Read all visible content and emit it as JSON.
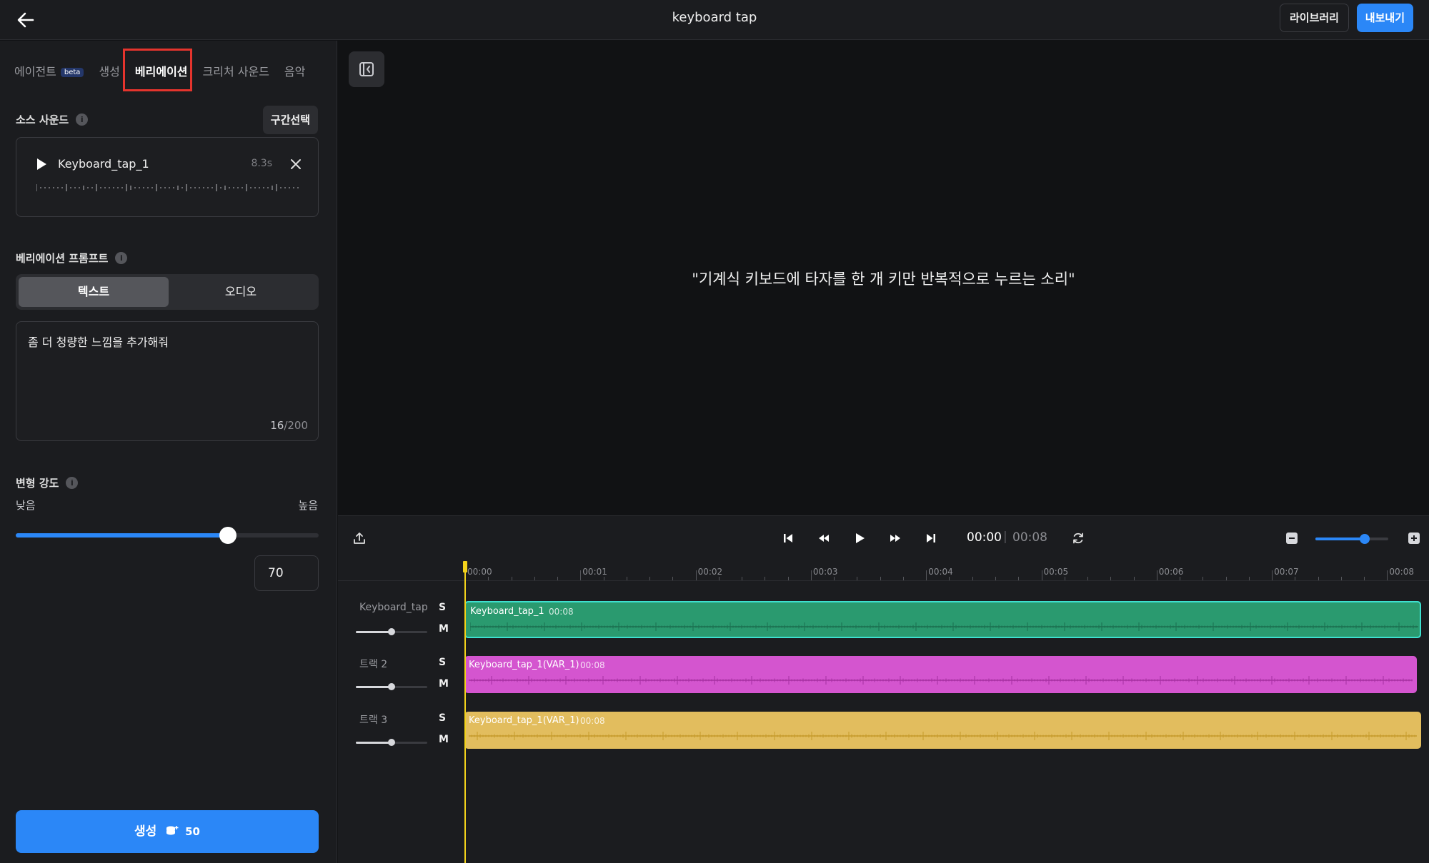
{
  "header": {
    "title": "keyboard tap",
    "library_label": "라이브러리",
    "export_label": "내보내기"
  },
  "left_panel": {
    "tabs": [
      {
        "label": "에이전트",
        "badge": "beta"
      },
      {
        "label": "생성"
      },
      {
        "label": "베리에이션",
        "active": true
      },
      {
        "label": "크리처 사운드"
      },
      {
        "label": "음악"
      }
    ],
    "source_sound": {
      "label": "소스 사운드",
      "info_icon": "info-icon",
      "range_select_label": "구간선택",
      "file_name": "Keyboard_tap_1",
      "duration": "8.3s"
    },
    "variation_prompt": {
      "label": "베리에이션 프롬프트",
      "modes": [
        "텍스트",
        "오디오"
      ],
      "active_mode": "텍스트",
      "text": "좀 더 청량한 느낌을 추가해줘",
      "char_count": "16",
      "char_limit": "/200"
    },
    "strength": {
      "label": "변형 강도",
      "min_label": "낮음",
      "max_label": "높음",
      "value": 70,
      "value_text": "70"
    },
    "generate": {
      "label": "생성",
      "credits_icon": "coins-icon",
      "cost": "50"
    }
  },
  "preview": {
    "quote": "\"기계식 키보드에 타자를 한 개 키만 반복적으로 누르는 소리\""
  },
  "transport": {
    "current_time": "00:00",
    "total_time": "00:08",
    "zoom_level": 0.68
  },
  "timeline": {
    "ruler": [
      "00:00",
      "00:01",
      "00:02",
      "00:03",
      "00:04",
      "00:05",
      "00:06",
      "00:07",
      "00:08"
    ],
    "tracks": [
      {
        "name": "Keyboard_tap",
        "solo": "S",
        "mute": "M",
        "volume": 0.5,
        "clip": {
          "label": "Keyboard_tap_1",
          "duration": "00:08",
          "color": "#2a9a6f",
          "selected": true
        }
      },
      {
        "name": "트랙 2",
        "solo": "S",
        "mute": "M",
        "volume": 0.5,
        "clip": {
          "label": "Keyboard_tap_1(VAR_1)",
          "duration": "00:08",
          "color": "#d455cf",
          "selected": false
        }
      },
      {
        "name": "트랙 3",
        "solo": "S",
        "mute": "M",
        "volume": 0.5,
        "clip": {
          "label": "Keyboard_tap_1(VAR_1)",
          "duration": "00:08",
          "color": "#e2bd5e",
          "selected": false
        }
      }
    ]
  },
  "colors": {
    "accent": "#2b87f7",
    "highlight": "#e5342d",
    "playhead": "#f2d21b"
  }
}
